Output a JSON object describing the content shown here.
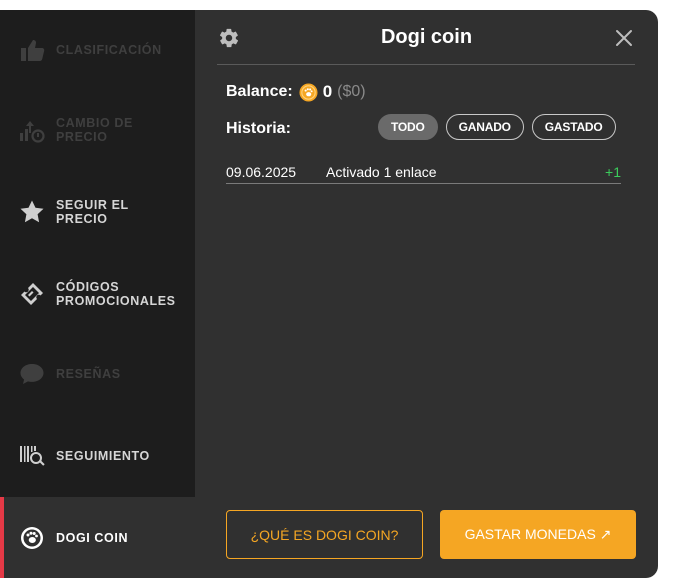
{
  "sidebar": {
    "items": [
      {
        "label": "CLASIFICACIÓN",
        "icon": "thumbs-up-icon"
      },
      {
        "label": "CAMBIO DE\nPRECIO",
        "icon": "price-change-icon"
      },
      {
        "label": "SEGUIR EL\nPRECIO",
        "icon": "star-icon"
      },
      {
        "label": "CÓDIGOS\nPROMOCIONALES",
        "icon": "ticket-icon"
      },
      {
        "label": "RESEÑAS",
        "icon": "chat-bubble-icon"
      },
      {
        "label": "SEGUIMIENTO",
        "icon": "barcode-search-icon"
      },
      {
        "label": "DOGI COIN",
        "icon": "paw-icon"
      }
    ]
  },
  "panel": {
    "title": "Dogi coin",
    "balance_label": "Balance:",
    "balance_amount": "0",
    "balance_usd": "($0)",
    "history_label": "Historia:",
    "filters": [
      "TODO",
      "GANADO",
      "GASTADO"
    ],
    "selected_filter": "TODO",
    "history": [
      {
        "date": "09.06.2025",
        "description": "Activado 1 enlace",
        "delta": "+1"
      }
    ],
    "what_is_button": "¿QUÉ ES DOGI COIN?",
    "spend_button": "GASTAR MONEDAS ↗"
  },
  "colors": {
    "accent": "#f5a623",
    "active_marker": "#e53946",
    "positive": "#3ccc5c",
    "panel_bg": "#303030",
    "sidebar_bg": "#1d1d1d"
  }
}
